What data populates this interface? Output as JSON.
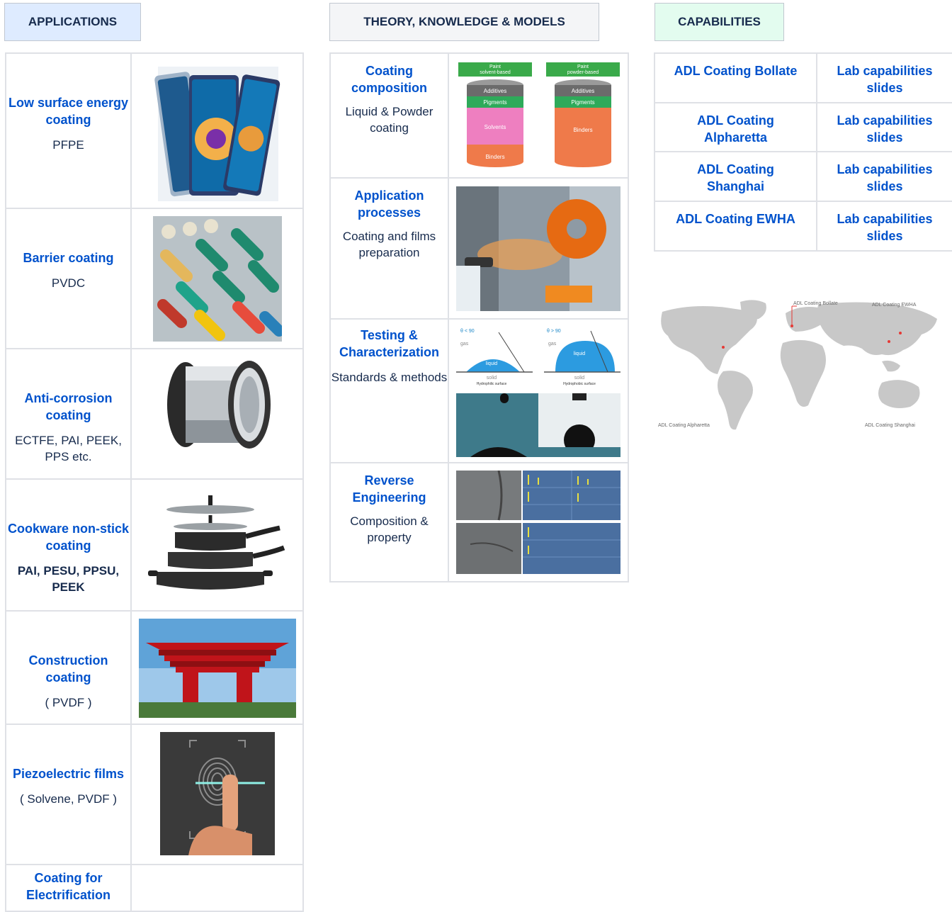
{
  "headers": {
    "applications": "APPLICATIONS",
    "theory": "THEORY, KNOWLEDGE & MODELS",
    "capabilities": "CAPABILITIES"
  },
  "colors": {
    "applications_header_bg": "#deebff",
    "theory_header_bg": "#f4f5f7",
    "capabilities_header_bg": "#e3fcef",
    "link": "#0052cc"
  },
  "applications": [
    {
      "title": "Low surface energy coating",
      "sub": "PFPE",
      "icon": "foldable-phone-image"
    },
    {
      "title": "Barrier coating",
      "sub": "PVDC",
      "icon": "blister-pack-image"
    },
    {
      "title": "Anti-corrosion coating",
      "sub": "ECTFE, PAI, PEEK, PPS etc.",
      "icon": "metal-duct-image"
    },
    {
      "title": "Cookware non-stick coating",
      "sub": "PAI, PESU, PPSU, PEEK",
      "icon": "cookware-image"
    },
    {
      "title": "Construction coating",
      "sub": "( PVDF )",
      "icon": "china-pavilion-image"
    },
    {
      "title": "Piezoelectric films",
      "sub": "( Solvene, PVDF )",
      "icon": "fingerprint-sensor-image"
    },
    {
      "title": "Coating for Electrification",
      "sub": "",
      "icon": ""
    }
  ],
  "theory": [
    {
      "title": "Coating composition",
      "sub": "Liquid & Powder coating",
      "figure": {
        "left_tag": "Paint",
        "left_tag2": "solvent-based",
        "right_tag": "Paint",
        "right_tag2": "powder-based",
        "additives": "Additives",
        "pigments": "Pigments",
        "solvents": "Solvents",
        "binders": "Binders"
      }
    },
    {
      "title": "Application processes",
      "sub": "Coating and films preparation"
    },
    {
      "title": "Testing & Characterization",
      "sub": "Standards & methods",
      "figure": {
        "angle_left": "θ < 90",
        "angle_right": "θ > 90",
        "gas": "gas",
        "liquid": "liquid",
        "solid": "solid",
        "surface_left": "Hydrophilic surface",
        "surface_right": "Hydrophobic surface"
      }
    },
    {
      "title": "Reverse Engineering",
      "sub": "Composition & property"
    }
  ],
  "capabilities": [
    {
      "site": "ADL Coating Bollate",
      "link": "Lab capabilities slides"
    },
    {
      "site": "ADL Coating Alpharetta",
      "link": "Lab capabilities slides"
    },
    {
      "site": "ADL Coating Shanghai",
      "link": "Lab capabilities slides"
    },
    {
      "site": "ADL Coating EWHA",
      "link": "Lab capabilities slides"
    }
  ],
  "map": {
    "label_bollate": "ADL Coating Bollate",
    "label_ewha": "ADL Coating EWHA",
    "label_alpharetta": "ADL Coating Alpharetta",
    "label_shanghai": "ADL Coating Shanghai"
  }
}
